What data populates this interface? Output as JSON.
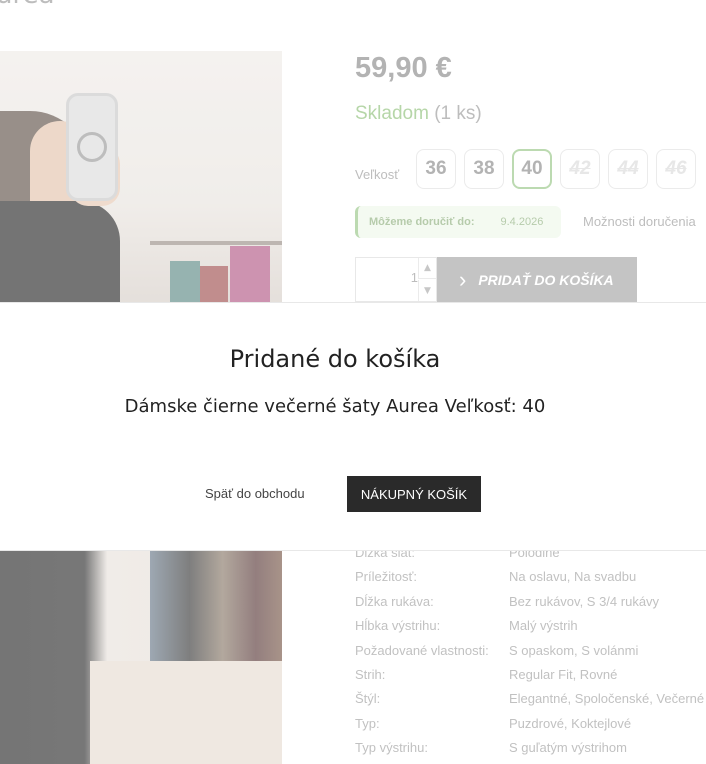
{
  "page": {
    "title_fragment": "urea"
  },
  "product": {
    "price": "59,90 €",
    "stock_status": "Skladom",
    "stock_qty": "(1 ks)",
    "size_label": "Veľkosť",
    "sizes": [
      {
        "label": "36",
        "state": "available"
      },
      {
        "label": "38",
        "state": "available"
      },
      {
        "label": "40",
        "state": "selected"
      },
      {
        "label": "42",
        "state": "unavailable"
      },
      {
        "label": "44",
        "state": "unavailable"
      },
      {
        "label": "46",
        "state": "unavailable"
      }
    ],
    "delivery_label": "Môžeme doručiť do:",
    "delivery_date": "9.4.2026",
    "delivery_options_link": "Možnosti doručenia",
    "quantity_value": "1",
    "add_to_cart_label": "PRIDAŤ DO KOŠÍKA"
  },
  "parameters": [
    {
      "key": "Dĺžka šiat:",
      "value": "Polodlhé"
    },
    {
      "key": "Príležitosť:",
      "value": "Na oslavu, Na svadbu"
    },
    {
      "key": "Dĺžka rukáva:",
      "value": "Bez rukávov, S 3/4 rukávy"
    },
    {
      "key": "Hĺbka výstrihu:",
      "value": "Malý výstrih"
    },
    {
      "key": "Požadované vlastnosti:",
      "value": "S opaskom, S volánmi"
    },
    {
      "key": "Strih:",
      "value": "Regular Fit, Rovné"
    },
    {
      "key": "Štýl:",
      "value": "Elegantné, Spoločenské, Večerné"
    },
    {
      "key": "Typ:",
      "value": "Puzdrové, Koktejlové"
    },
    {
      "key": "Typ výstrihu:",
      "value": "S guľatým výstrihom"
    }
  ],
  "modal": {
    "title": "Pridané do košíka",
    "product_line": "Dámske čierne večerné šaty Aurea Veľkosť: 40",
    "back_label": "Späť do obchodu",
    "cart_label": "NÁKUPNÝ KOŠÍK"
  },
  "colors": {
    "accent_green": "#98c688",
    "button_dark": "#2a2a2a",
    "button_gray": "#a5a5a5"
  }
}
